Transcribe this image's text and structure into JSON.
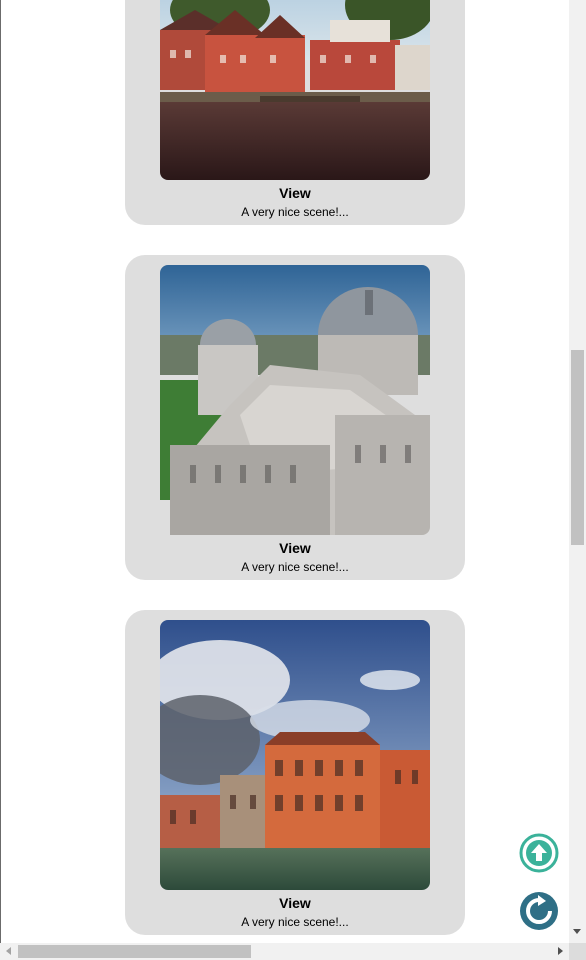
{
  "cards": [
    {
      "title": "View",
      "description": "A very nice scene!..."
    },
    {
      "title": "View",
      "description": "A very nice scene!..."
    },
    {
      "title": "View",
      "description": "A very nice scene!..."
    }
  ],
  "floating_buttons": {
    "scroll_top_icon": "arrow-up-circle-icon",
    "refresh_icon": "refresh-circle-icon"
  },
  "colors": {
    "card_background": "#dedede",
    "scroll_top_accent": "#3bb29a",
    "refresh_accent": "#2f6f86"
  }
}
